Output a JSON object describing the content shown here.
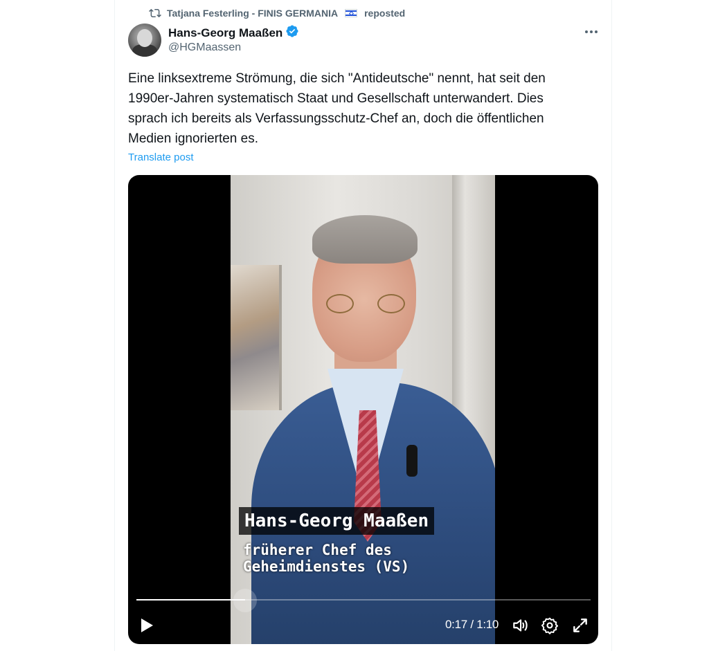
{
  "repost": {
    "text": "Tatjana Festerling - FINIS GERMANIA",
    "suffix": "reposted"
  },
  "author": {
    "display_name": "Hans-Georg Maaßen",
    "handle": "@HGMaassen",
    "verified": true
  },
  "post": {
    "text": "Eine linksextreme Strömung, die sich \"Antideutsche\" nennt, hat seit den\n1990er-Jahren systematisch Staat und Gesellschaft unterwandert. Dies\nsprach ich bereits als Verfassungsschutz-Chef an, doch die öffentlichen\nMedien ignorierten es.",
    "translate_label": "Translate post"
  },
  "video": {
    "caption_name": "Hans-Georg Maaßen",
    "caption_line1": "früherer Chef des",
    "caption_line2": "Geheimdienstes (VS)",
    "current_time": "0:17",
    "separator": "/",
    "duration": "1:10",
    "progress": 0.24
  },
  "icons": [
    "repost-icon",
    "verified-badge-icon",
    "more-icon",
    "play-icon",
    "volume-icon",
    "settings-icon",
    "fullscreen-icon"
  ],
  "colors": {
    "accent": "#1d9bf0",
    "secondary_text": "#536471",
    "video_bg": "#000000"
  }
}
